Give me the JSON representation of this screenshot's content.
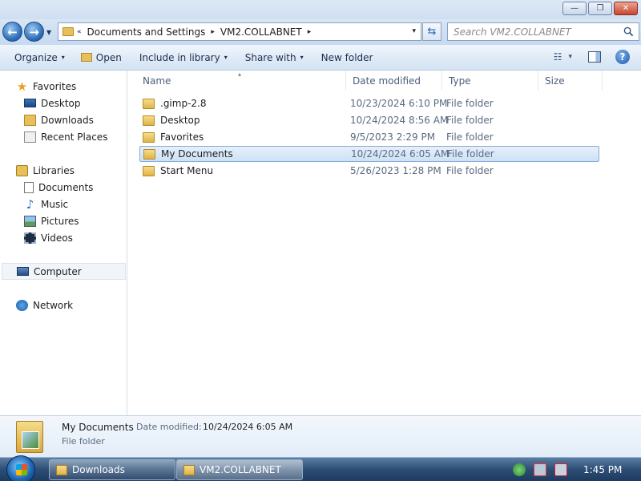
{
  "window": {
    "minimize_glyph": "—",
    "maximize_glyph": "❐",
    "close_glyph": "✕"
  },
  "address": {
    "overflow": "«",
    "crumbs": [
      "Documents and Settings",
      "VM2.COLLABNET"
    ],
    "separator": "▸",
    "dropdown": "▾",
    "refresh_glyph": "⇆"
  },
  "search": {
    "placeholder": "Search VM2.COLLABNET"
  },
  "command_bar": {
    "organize": "Organize",
    "open": "Open",
    "include_in_library": "Include in library",
    "share_with": "Share with",
    "new_folder": "New folder",
    "caret": "▾",
    "help_glyph": "?"
  },
  "nav": {
    "favorites": "Favorites",
    "desktop": "Desktop",
    "downloads": "Downloads",
    "recent_places": "Recent Places",
    "libraries": "Libraries",
    "documents": "Documents",
    "music": "Music",
    "pictures": "Pictures",
    "videos": "Videos",
    "computer": "Computer",
    "network": "Network"
  },
  "columns": {
    "name": "Name",
    "date_modified": "Date modified",
    "type": "Type",
    "size": "Size"
  },
  "files": [
    {
      "name": ".gimp-2.8",
      "date": "10/23/2024 6:10 PM",
      "type": "File folder"
    },
    {
      "name": "Desktop",
      "date": "10/24/2024 8:56 AM",
      "type": "File folder"
    },
    {
      "name": "Favorites",
      "date": "9/5/2023 2:29 PM",
      "type": "File folder"
    },
    {
      "name": "My Documents",
      "date": "10/24/2024 6:05 AM",
      "type": "File folder"
    },
    {
      "name": "Start Menu",
      "date": "5/26/2023 1:28 PM",
      "type": "File folder"
    }
  ],
  "details": {
    "name": "My Documents",
    "date_label": "Date modified:",
    "date_value": "10/24/2024 6:05 AM",
    "type": "File folder"
  },
  "taskbar": {
    "task1": "Downloads",
    "task2": "VM2.COLLABNET",
    "clock": "1:45 PM"
  }
}
